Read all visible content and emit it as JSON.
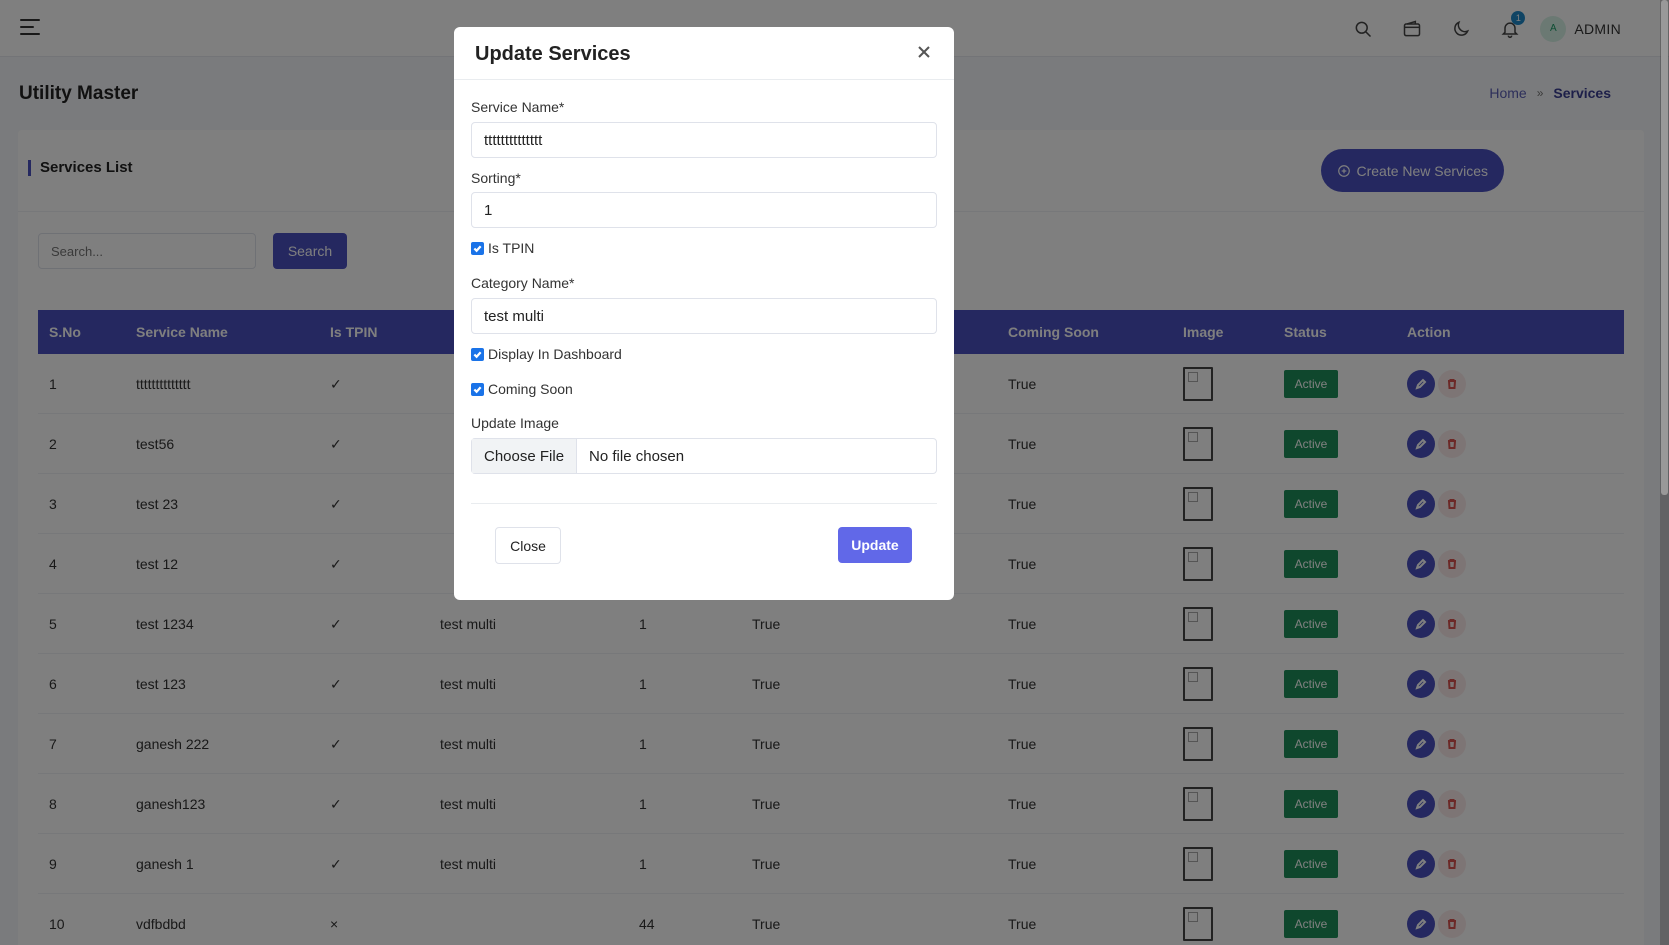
{
  "header": {
    "user_initial": "A",
    "user_name": "ADMIN",
    "notification_count": "1"
  },
  "page": {
    "title": "Utility Master",
    "breadcrumb_home": "Home",
    "breadcrumb_separator": "»",
    "breadcrumb_current": "Services"
  },
  "card": {
    "title": "Services List",
    "create_button": "Create New Services",
    "search_placeholder": "Search...",
    "search_button": "Search"
  },
  "table": {
    "columns": [
      "S.No",
      "Service Name",
      "Is TPIN",
      "",
      "",
      "",
      "Coming Soon",
      "Image",
      "Status",
      "Action"
    ],
    "rows": [
      {
        "sno": "1",
        "name": "tttttttttttttt",
        "tpin": "✓",
        "category": "",
        "sorting": "",
        "display": "",
        "coming_soon": "True",
        "status": "Active"
      },
      {
        "sno": "2",
        "name": "test56",
        "tpin": "✓",
        "category": "",
        "sorting": "",
        "display": "",
        "coming_soon": "True",
        "status": "Active"
      },
      {
        "sno": "3",
        "name": "test 23",
        "tpin": "✓",
        "category": "",
        "sorting": "",
        "display": "",
        "coming_soon": "True",
        "status": "Active"
      },
      {
        "sno": "4",
        "name": "test 12",
        "tpin": "✓",
        "category": "",
        "sorting": "",
        "display": "",
        "coming_soon": "True",
        "status": "Active"
      },
      {
        "sno": "5",
        "name": "test 1234",
        "tpin": "✓",
        "category": "test multi",
        "sorting": "1",
        "display": "True",
        "coming_soon": "True",
        "status": "Active"
      },
      {
        "sno": "6",
        "name": "test 123",
        "tpin": "✓",
        "category": "test multi",
        "sorting": "1",
        "display": "True",
        "coming_soon": "True",
        "status": "Active"
      },
      {
        "sno": "7",
        "name": "ganesh 222",
        "tpin": "✓",
        "category": "test multi",
        "sorting": "1",
        "display": "True",
        "coming_soon": "True",
        "status": "Active"
      },
      {
        "sno": "8",
        "name": "ganesh123",
        "tpin": "✓",
        "category": "test multi",
        "sorting": "1",
        "display": "True",
        "coming_soon": "True",
        "status": "Active"
      },
      {
        "sno": "9",
        "name": "ganesh 1",
        "tpin": "✓",
        "category": "test multi",
        "sorting": "1",
        "display": "True",
        "coming_soon": "True",
        "status": "Active"
      },
      {
        "sno": "10",
        "name": "vdfbdbd",
        "tpin": "×",
        "category": "",
        "sorting": "44",
        "display": "True",
        "coming_soon": "True",
        "status": "Active"
      }
    ]
  },
  "modal": {
    "title": "Update Services",
    "service_name_label": "Service Name*",
    "service_name_value": "tttttttttttttt",
    "sorting_label": "Sorting*",
    "sorting_value": "1",
    "is_tpin_label": "Is TPIN",
    "category_label": "Category Name*",
    "category_value": "test multi",
    "display_dashboard_label": "Display In Dashboard",
    "coming_soon_label": "Coming Soon",
    "update_image_label": "Update Image",
    "choose_file_label": "Choose File",
    "file_status": "No file chosen",
    "close_button": "Close",
    "update_button": "Update"
  },
  "colors": {
    "primary": "#4a50c0",
    "update_button": "#6168e8",
    "status_active": "#1e8f5a",
    "checkbox": "#1a73e8"
  }
}
